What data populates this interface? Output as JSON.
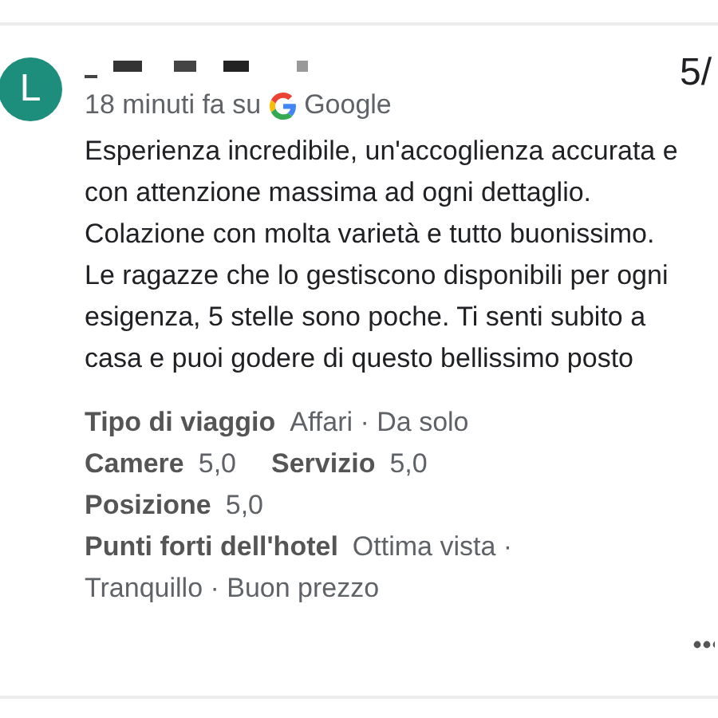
{
  "review": {
    "avatar_letter": "L",
    "rating": "5/",
    "time": "18 minuti fa su",
    "source": "Google",
    "text": "Esperienza incredibile, un'accoglienza accurata e con attenzione massima ad ogni dettaglio. Colazione con molta varietà e tutto buonissimo. Le ragazze che lo gestiscono disponibili per ogni esigenza, 5 stelle sono poche. Ti senti subito a casa e puoi godere di questo bellissimo posto",
    "details": [
      [
        {
          "label": "Tipo di viaggio",
          "value": "Affari · Da solo"
        }
      ],
      [
        {
          "label": "Camere",
          "value": "5,0"
        },
        {
          "label": "Servizio",
          "value": "5,0"
        }
      ],
      [
        {
          "label": "Posizione",
          "value": "5,0"
        }
      ],
      [
        {
          "label": "Punti forti dell'hotel",
          "value": "Ottima vista · Tranquillo · Buon prezzo"
        }
      ]
    ]
  }
}
